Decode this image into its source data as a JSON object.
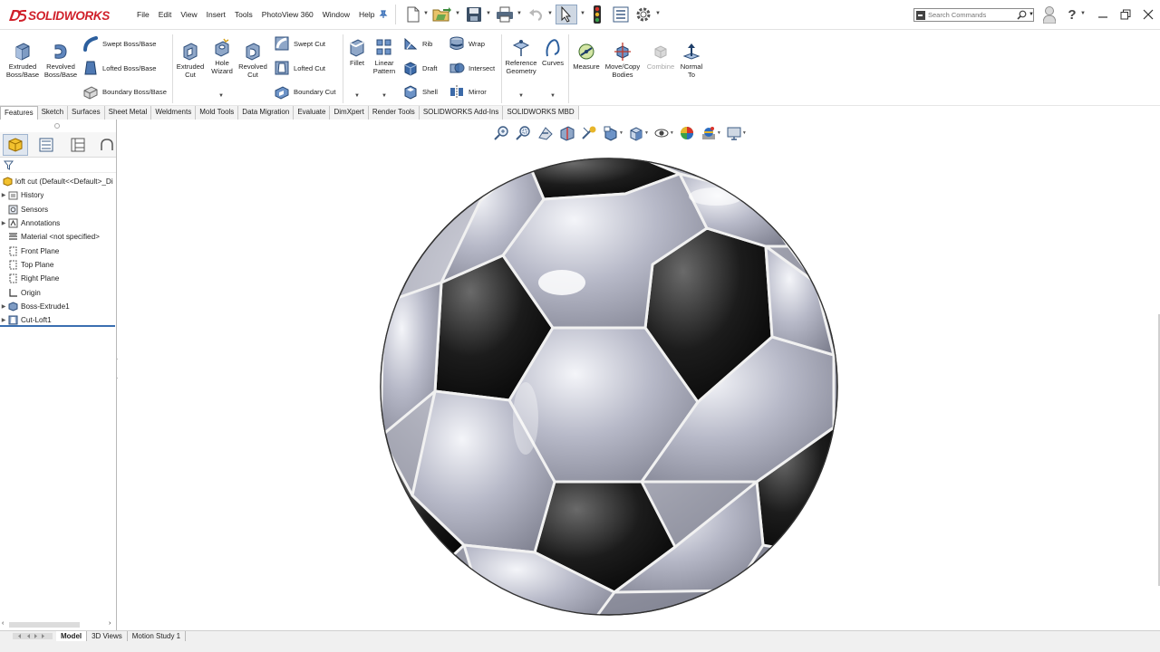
{
  "app": {
    "name": "SOLIDWORKS"
  },
  "menu": [
    "File",
    "Edit",
    "View",
    "Insert",
    "Tools",
    "PhotoView 360",
    "Window",
    "Help"
  ],
  "search": {
    "placeholder": "Search Commands"
  },
  "ribbon": {
    "extruded_boss": "Extruded Boss/Base",
    "revolved_boss": "Revolved Boss/Base",
    "swept_boss": "Swept Boss/Base",
    "lofted_boss": "Lofted Boss/Base",
    "boundary_boss": "Boundary Boss/Base",
    "extruded_cut": "Extruded Cut",
    "hole_wizard": "Hole Wizard",
    "revolved_cut": "Revolved Cut",
    "swept_cut": "Swept Cut",
    "lofted_cut": "Lofted Cut",
    "boundary_cut": "Boundary Cut",
    "fillet": "Fillet",
    "linear_pattern": "Linear Pattern",
    "rib": "Rib",
    "draft": "Draft",
    "shell": "Shell",
    "wrap": "Wrap",
    "intersect": "Intersect",
    "mirror": "Mirror",
    "reference_geometry": "Reference Geometry",
    "curves": "Curves",
    "measure": "Measure",
    "move_copy": "Move/Copy Bodies",
    "combine": "Combine",
    "normal_to": "Normal To"
  },
  "tabs": [
    "Features",
    "Sketch",
    "Surfaces",
    "Sheet Metal",
    "Weldments",
    "Mold Tools",
    "Data Migration",
    "Evaluate",
    "DimXpert",
    "Render Tools",
    "SOLIDWORKS Add-Ins",
    "SOLIDWORKS MBD"
  ],
  "tree": {
    "root": "loft cut  (Default<<Default>_Di",
    "items": [
      "History",
      "Sensors",
      "Annotations",
      "Material <not specified>",
      "Front Plane",
      "Top Plane",
      "Right Plane",
      "Origin",
      "Boss-Extrude1",
      "Cut-Loft1"
    ]
  },
  "bottom_tabs": [
    "Model",
    "3D Views",
    "Motion Study 1"
  ]
}
